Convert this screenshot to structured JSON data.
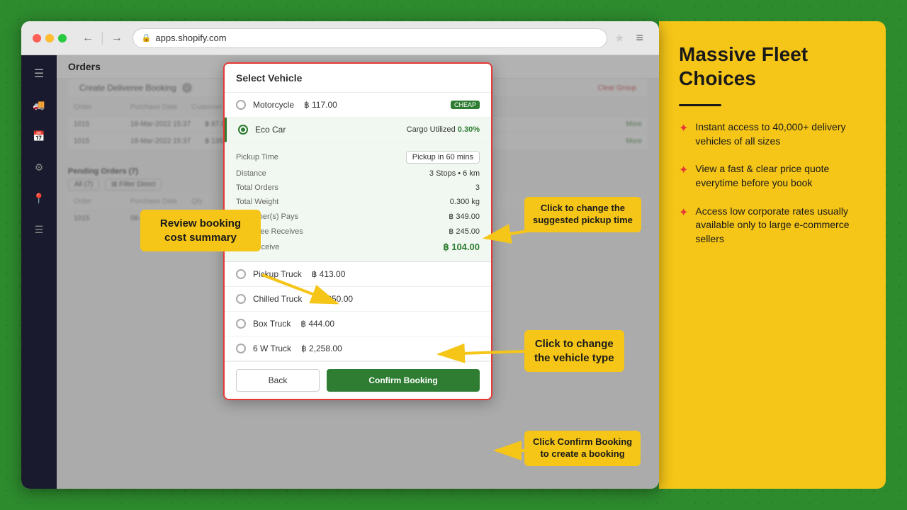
{
  "browser": {
    "url": "apps.shopify.com"
  },
  "page": {
    "title": "Orders",
    "create_booking_label": "Create Deliveree Booking",
    "clear_group": "Clear Group"
  },
  "modal": {
    "title": "Select Vehicle",
    "vehicles": [
      {
        "id": "motorcycle",
        "name": "Motorcycle",
        "price": "฿ 117.00",
        "badge": "CHEAP",
        "selected": false
      },
      {
        "id": "eco_car",
        "name": "Eco Car",
        "price": "",
        "cargo": "Cargo Utilized",
        "cargo_pct": "0.30%",
        "selected": true
      },
      {
        "id": "pickup_truck",
        "name": "Pickup Truck",
        "price": "฿ 413.00",
        "selected": false
      },
      {
        "id": "chilled_truck",
        "name": "Chilled Truck",
        "price": "฿ 1,250.00",
        "selected": false
      },
      {
        "id": "box_truck",
        "name": "Box Truck",
        "price": "฿ 444.00",
        "selected": false
      },
      {
        "id": "6w_truck",
        "name": "6 W Truck",
        "price": "฿ 2,258.00",
        "selected": false
      }
    ],
    "eco_details": {
      "pickup_time_label": "Pickup Time",
      "pickup_time_value": "Pickup in 60 mins",
      "distance_label": "Distance",
      "distance_value": "3 Stops • 6 km",
      "total_orders_label": "Total Orders",
      "total_orders_value": "3",
      "total_weight_label": "Total Weight",
      "total_weight_value": "0.300 kg",
      "customers_pays_label": "Customer(s) Pays",
      "customers_pays_value": "฿ 349.00",
      "deliveree_receives_label": "Deliveree Receives",
      "deliveree_receives_value": "฿ 245.00",
      "you_receive_label": "You Receive",
      "you_receive_value": "฿ 104.00"
    },
    "back_btn": "Back",
    "confirm_btn": "Confirm Booking"
  },
  "callouts": {
    "review_booking": "Review booking\ncost summary",
    "pickup_time": "Click to change the\nsuggested pickup time",
    "vehicle_type": "Click to change\nthe vehicle type",
    "confirm_booking": "Click Confirm Booking\nto create a booking"
  },
  "right_panel": {
    "title": "Massive Fleet Choices",
    "features": [
      "Instant access to 40,000+ delivery vehicles of all sizes",
      "View a fast & clear price quote everytime before you book",
      "Access low corporate rates usually available only to large e-commerce sellers"
    ]
  }
}
